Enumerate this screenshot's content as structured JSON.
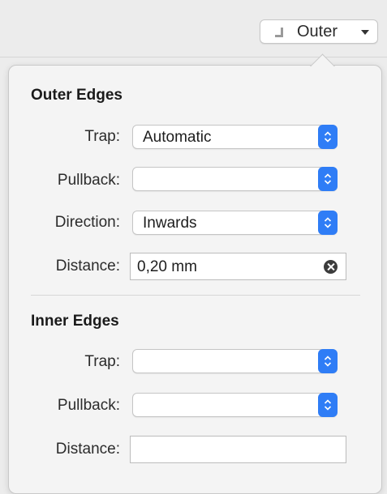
{
  "toolbar": {
    "edge_button_label": "Outer",
    "edge_button_icon": "corner-edge-icon"
  },
  "outer_edges": {
    "title": "Outer Edges",
    "trap_label": "Trap:",
    "trap_value": "Automatic",
    "pullback_label": "Pullback:",
    "pullback_value": "",
    "direction_label": "Direction:",
    "direction_value": "Inwards",
    "distance_label": "Distance:",
    "distance_value": "0,20 mm"
  },
  "inner_edges": {
    "title": "Inner Edges",
    "trap_label": "Trap:",
    "trap_value": "",
    "pullback_label": "Pullback:",
    "pullback_value": "",
    "distance_label": "Distance:",
    "distance_value": ""
  },
  "colors": {
    "accent": "#2f7df6",
    "panel": "#f4f4f4",
    "background": "#ececec"
  }
}
